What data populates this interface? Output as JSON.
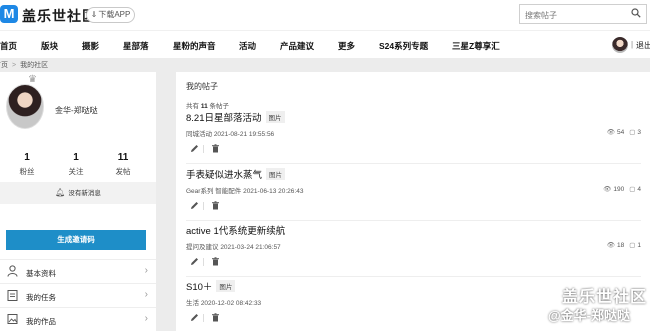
{
  "header": {
    "logo_letter": "M",
    "site_name": "盖乐世社区",
    "download_label": "下载APP",
    "search_placeholder": "搜索帖子"
  },
  "nav": {
    "items": [
      "首页",
      "版块",
      "摄影",
      "星部落",
      "星粉的声音",
      "活动",
      "产品建议",
      "更多",
      "S24系列专题",
      "三星Z尊享汇"
    ],
    "separator": "|",
    "logout_label": "退出"
  },
  "breadcrumb": {
    "home": "首页",
    "separator": ">",
    "current": "我的社区"
  },
  "profile": {
    "username": "金华-郑哒哒",
    "stats": [
      {
        "value": "1",
        "label": "粉丝"
      },
      {
        "value": "1",
        "label": "关注"
      },
      {
        "value": "11",
        "label": "发帖"
      }
    ],
    "message_text": "没有新消息",
    "invite_button": "生成邀请码",
    "menu": [
      "基本资料",
      "我的任务",
      "我的作品"
    ]
  },
  "posts_panel": {
    "title": "我的帖子",
    "count_prefix": "共有",
    "count": "11",
    "count_suffix": "条帖子",
    "posts": [
      {
        "title": "8.21日星部落活动",
        "badge": "图片",
        "category": "同城活动",
        "time": "2021-08-21 19:55:56",
        "views": "54",
        "comments": "3"
      },
      {
        "title": "手表疑似进水蒸气",
        "badge": "图片",
        "category": "Gear系列 智能配件",
        "time": "2021-06-13 20:26:43",
        "views": "190",
        "comments": "4"
      },
      {
        "title": "active 1代系统更新续航",
        "badge": "",
        "category": "提问及建议",
        "time": "2021-03-24 21:06:57",
        "views": "18",
        "comments": "1"
      },
      {
        "title": "S10＋",
        "badge": "图片",
        "category": "生活",
        "time": "2020-12-02 08:42:33",
        "views": "",
        "comments": ""
      }
    ]
  },
  "watermark": {
    "line1": "盖乐世社区",
    "line2": "@金华-郑哒哒"
  },
  "colors": {
    "brand": "#1e88e5",
    "invite_button": "#1e8ec8",
    "background": "#ececec"
  }
}
